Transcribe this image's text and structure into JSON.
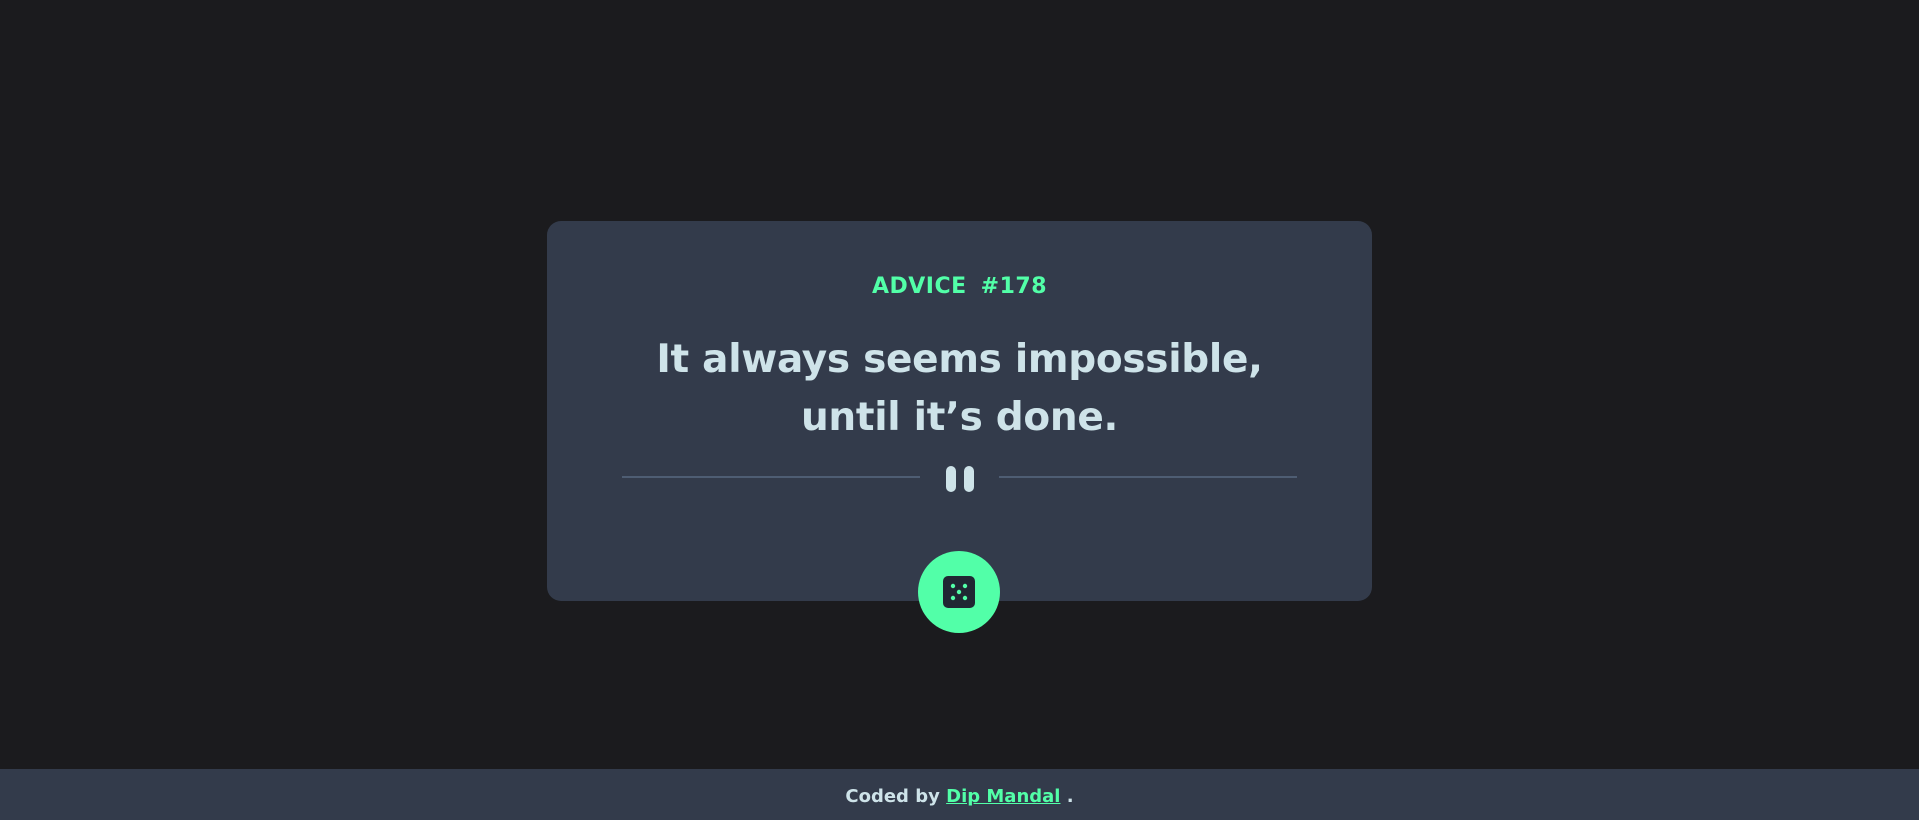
{
  "card": {
    "label": "ADVICE",
    "number": "#178",
    "quote": "It always seems impossible, until it’s done."
  },
  "divider": {
    "icon": "pause-icon"
  },
  "button": {
    "icon": "dice-icon"
  },
  "footer": {
    "prefix": "Coded by",
    "author": "Dip Mandal",
    "suffix": "."
  },
  "colors": {
    "background": "#1b1b1e",
    "card": "#333b4b",
    "accent": "#52ffa8",
    "text": "#cee3e9",
    "divider": "#4e5d73"
  }
}
